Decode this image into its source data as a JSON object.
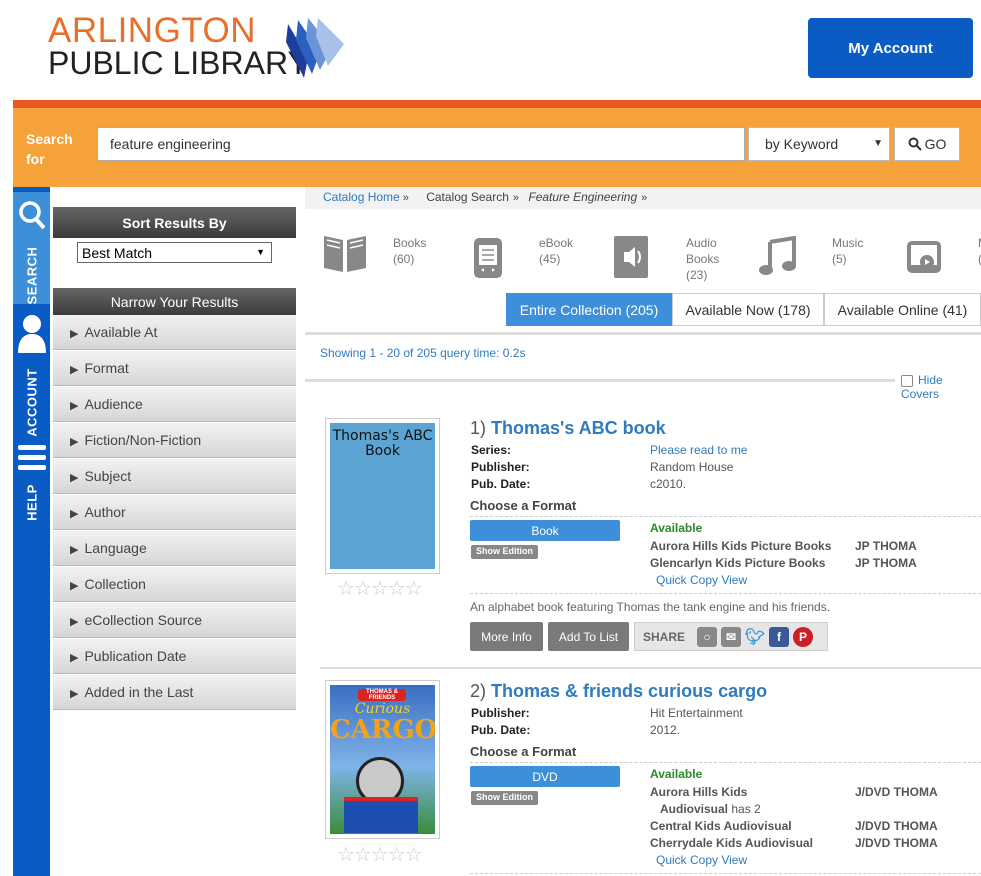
{
  "logo": {
    "line1": "ARLINGTON",
    "line2": "PUBLIC LIBRARY"
  },
  "header": {
    "my_account": "My Account"
  },
  "search": {
    "label": "Search for",
    "query": "feature engineering",
    "type": "by Keyword",
    "go": "GO"
  },
  "rail": {
    "search": "SEARCH",
    "account": "ACCOUNT",
    "help": "HELP"
  },
  "sidebar": {
    "sort_title": "Sort Results By",
    "sort_value": "Best Match",
    "narrow_title": "Narrow Your Results",
    "facets": [
      "Available At",
      "Format",
      "Audience",
      "Fiction/Non-Fiction",
      "Subject",
      "Author",
      "Language",
      "Collection",
      "eCollection Source",
      "Publication Date",
      "Added in the Last"
    ]
  },
  "breadcrumb": {
    "home": "Catalog Home",
    "search": "Catalog Search",
    "term": "Feature Engineering"
  },
  "formats": [
    {
      "label": "Books",
      "count": "(60)",
      "icon": "book-icon"
    },
    {
      "label": "eBook",
      "count": "(45)",
      "icon": "ebook-icon"
    },
    {
      "label": "Audio Books",
      "count": "(23)",
      "icon": "audiobook-icon"
    },
    {
      "label": "Music",
      "count": "(5)",
      "icon": "music-icon"
    },
    {
      "label": "M",
      "count": "(",
      "icon": "video-icon"
    }
  ],
  "tabs": {
    "entire": "Entire Collection (205)",
    "now": "Available Now (178)",
    "online": "Available Online (41)"
  },
  "showing": "Showing 1 - 20 of 205 query time: 0.2s",
  "hide_covers": "Hide Covers",
  "labels": {
    "series": "Series:",
    "publisher": "Publisher:",
    "pubdate": "Pub. Date:",
    "choose": "Choose a Format",
    "show_edition": "Show Edition",
    "available": "Available",
    "quick_copy": "Quick Copy View",
    "more_info": "More Info",
    "add_to_list": "Add To List",
    "share": "SHARE"
  },
  "results": [
    {
      "num": "1)",
      "title": "Thomas's ABC book",
      "cover_text": "Thomas's ABC Book",
      "series": "Please read to me",
      "publisher": "Random House",
      "pubdate": "c2010.",
      "format": "Book",
      "holdings": [
        {
          "loc": "Aurora Hills Kids Picture Books",
          "call": "JP THOMA"
        },
        {
          "loc": "Glencarlyn Kids Picture Books",
          "call": "JP THOMA"
        }
      ],
      "desc": "An alphabet book featuring Thomas the tank engine and his friends."
    },
    {
      "num": "2)",
      "title": "Thomas & friends curious cargo",
      "cover_line1": "THOMAS & FRIENDS",
      "cover_line2": "Curious",
      "cover_line3": "CARGO",
      "publisher": "Hit Entertainment",
      "pubdate": "2012.",
      "format": "DVD",
      "holdings": [
        {
          "loc": "Aurora Hills Kids",
          "loc2": "Audiovisual",
          "has": "has 2",
          "call": "J/DVD THOMA"
        },
        {
          "loc": "Central Kids Audiovisual",
          "call": "J/DVD THOMA"
        },
        {
          "loc": "Cherrydale Kids Audiovisual",
          "call": "J/DVD THOMA"
        }
      ]
    }
  ],
  "colors": {
    "orange": "#f6a23a",
    "red": "#e65a1e",
    "blue": "#0b5bc4",
    "link": "#2f7bbd",
    "green": "#2a8a2a"
  }
}
